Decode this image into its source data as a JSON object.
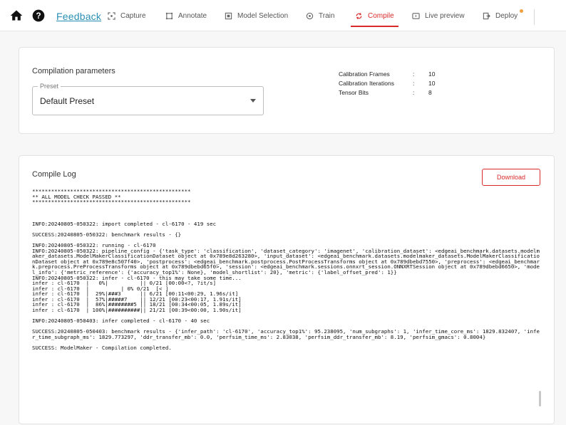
{
  "nav": {
    "feedback_label": "Feedback",
    "tabs": [
      {
        "label": "Capture",
        "icon": "capture-icon"
      },
      {
        "label": "Annotate",
        "icon": "annotate-icon"
      },
      {
        "label": "Model Selection",
        "icon": "model-selection-icon"
      },
      {
        "label": "Train",
        "icon": "train-icon"
      },
      {
        "label": "Compile",
        "icon": "compile-icon",
        "active": true
      },
      {
        "label": "Live preview",
        "icon": "live-preview-icon"
      },
      {
        "label": "Deploy",
        "icon": "deploy-icon",
        "badge": true
      }
    ]
  },
  "params": {
    "title": "Compilation parameters",
    "preset_label": "Preset",
    "preset_value": "Default Preset",
    "stats": [
      {
        "label": "Calibration Frames",
        "value": "10"
      },
      {
        "label": "Calibration Iterations",
        "value": "10"
      },
      {
        "label": "Tensor Bits",
        "value": "8"
      }
    ]
  },
  "log": {
    "title": "Compile Log",
    "download_label": "Download",
    "lines": [
      "**************************************************",
      "** ALL MODEL CHECK PASSED **",
      "**************************************************",
      "",
      "",
      "",
      "INFO:20240805-050322: import completed - cl-6170 - 419 sec",
      "",
      "SUCCESS:20240805-050322: benchmark results - {}",
      "",
      "INFO:20240805-050322: running - cl-6170",
      "INFO:20240805-050322: pipeline_config - {'task_type': 'classification', 'dataset_category': 'imagenet', 'calibration_dataset': <edgeai_benchmark.datasets.modelmaker_datasets.ModelMakerClassificationDataset object at 0x789e8d263280>, 'input_dataset': <edgeai_benchmark.datasets.modelmaker_datasets.ModelMakerClassificationDataset object at 0x789e8c507f40>, 'postprocess': <edgeai_benchmark.postprocess.PostProcessTransforms object at 0x789dbebd7550>, 'preprocess': <edgeai_benchmark.preprocess.PreProcessTransforms object at 0x789dbebd65f0>, 'session': <edgeai_benchmark.sessions.onnxrt_session.ONNXRTSession object at 0x789dbebd6650>, 'model_info': {'metric_reference': {'accuracy_top1%': None}, 'model_shortlist': 20}, 'metric': {'label_offset_pred': 1}}",
      "INFO:20240805-050322: infer - cl-6170 - this may take some time...",
      "infer : cl-6170  |   0%|          || 0/21 [00:00<?, ?it/s]",
      "infer : cl-6170  |          | 0% 0/21  [< ]",
      "infer : cl-6170  |  29%|###3      || 6/21 [00:11<00:29, 1.96s/it]",
      "infer : cl-6170  |  57%|#####7    || 12/21 [00:23<00:17, 1.91s/it]",
      "infer : cl-6170  |  86%|########5 || 18/21 [00:34<00:05, 1.89s/it]",
      "infer : cl-6170  | 100%|##########|| 21/21 [00:39<00:00, 1.90s/it]",
      "",
      "INFO:20240805-050403: infer completed - cl-6170 - 40 sec",
      "",
      "SUCCESS:20240805-050403: benchmark results - {'infer_path': 'cl-6170', 'accuracy_top1%': 95.238095, 'num_subgraphs': 1, 'infer_time_core_ms': 1829.832407, 'infer_time_subgraph_ms': 1829.773297, 'ddr_transfer_mb': 0.0, 'perfsim_time_ms': 2.83038, 'perfsim_ddr_transfer_mb': 8.19, 'perfsim_gmacs': 0.8004}",
      "",
      "SUCCESS: ModelMaker - Compilation completed."
    ]
  }
}
